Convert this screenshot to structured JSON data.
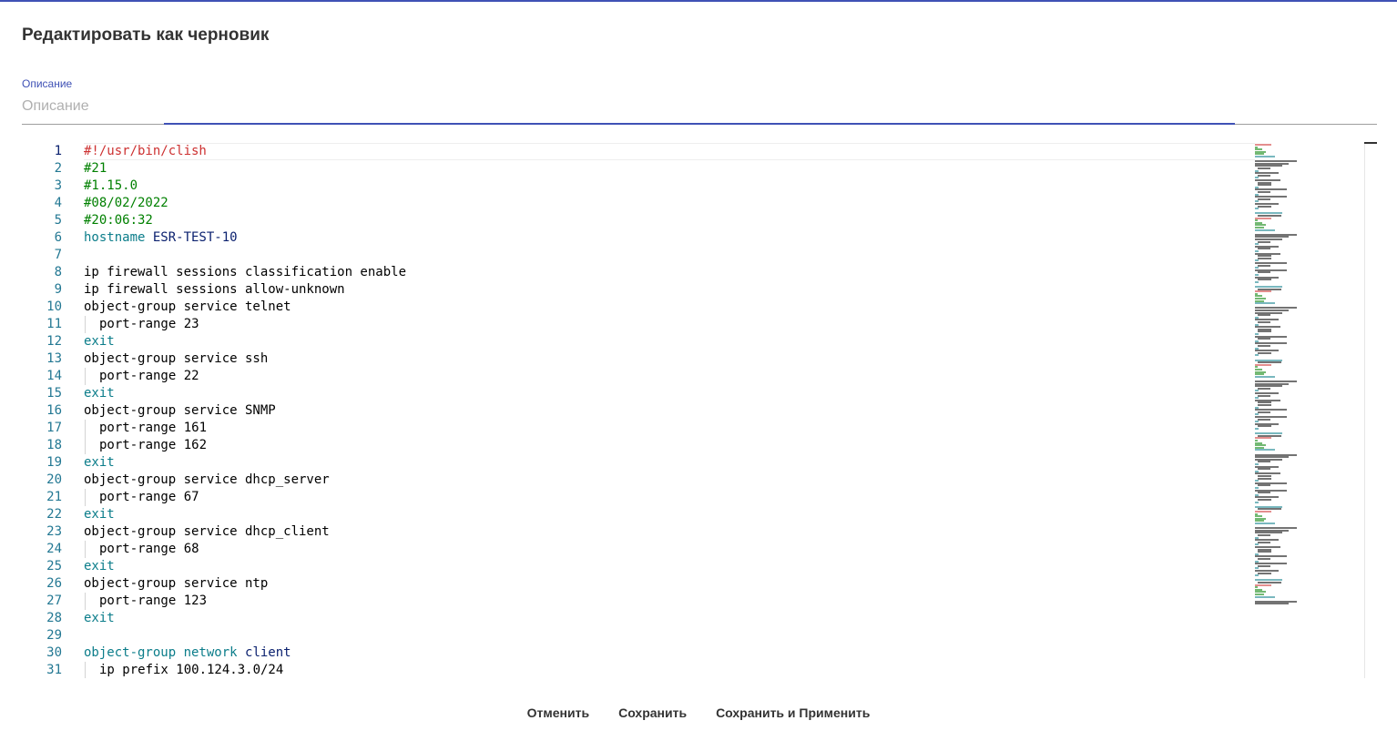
{
  "dialog": {
    "title": "Редактировать как черновик"
  },
  "description": {
    "label": "Описание",
    "placeholder": "Описание",
    "value": ""
  },
  "editor": {
    "active_line": 1,
    "lines": [
      {
        "n": "1",
        "indent": 0,
        "tokens": [
          {
            "t": "#!/usr/bin/clish",
            "c": "shebang"
          }
        ]
      },
      {
        "n": "2",
        "indent": 0,
        "tokens": [
          {
            "t": "#21",
            "c": "comment"
          }
        ]
      },
      {
        "n": "3",
        "indent": 0,
        "tokens": [
          {
            "t": "#1.15.0",
            "c": "comment"
          }
        ]
      },
      {
        "n": "4",
        "indent": 0,
        "tokens": [
          {
            "t": "#08/02/2022",
            "c": "comment"
          }
        ]
      },
      {
        "n": "5",
        "indent": 0,
        "tokens": [
          {
            "t": "#20:06:32",
            "c": "comment"
          }
        ]
      },
      {
        "n": "6",
        "indent": 0,
        "tokens": [
          {
            "t": "hostname ",
            "c": "key"
          },
          {
            "t": "ESR-TEST-10",
            "c": "val"
          }
        ]
      },
      {
        "n": "7",
        "indent": 0,
        "tokens": []
      },
      {
        "n": "8",
        "indent": 0,
        "tokens": [
          {
            "t": "ip firewall sessions classification enable",
            "c": "plain"
          }
        ]
      },
      {
        "n": "9",
        "indent": 0,
        "tokens": [
          {
            "t": "ip firewall sessions allow-unknown",
            "c": "plain"
          }
        ]
      },
      {
        "n": "10",
        "indent": 0,
        "tokens": [
          {
            "t": "object-group service telnet",
            "c": "plain"
          }
        ]
      },
      {
        "n": "11",
        "indent": 1,
        "tokens": [
          {
            "t": "port-range 23",
            "c": "plain"
          }
        ]
      },
      {
        "n": "12",
        "indent": 0,
        "tokens": [
          {
            "t": "exit",
            "c": "key"
          }
        ]
      },
      {
        "n": "13",
        "indent": 0,
        "tokens": [
          {
            "t": "object-group service ssh",
            "c": "plain"
          }
        ]
      },
      {
        "n": "14",
        "indent": 1,
        "tokens": [
          {
            "t": "port-range 22",
            "c": "plain"
          }
        ]
      },
      {
        "n": "15",
        "indent": 0,
        "tokens": [
          {
            "t": "exit",
            "c": "key"
          }
        ]
      },
      {
        "n": "16",
        "indent": 0,
        "tokens": [
          {
            "t": "object-group service SNMP",
            "c": "plain"
          }
        ]
      },
      {
        "n": "17",
        "indent": 1,
        "tokens": [
          {
            "t": "port-range 161",
            "c": "plain"
          }
        ]
      },
      {
        "n": "18",
        "indent": 1,
        "tokens": [
          {
            "t": "port-range 162",
            "c": "plain"
          }
        ]
      },
      {
        "n": "19",
        "indent": 0,
        "tokens": [
          {
            "t": "exit",
            "c": "key"
          }
        ]
      },
      {
        "n": "20",
        "indent": 0,
        "tokens": [
          {
            "t": "object-group service dhcp_server",
            "c": "plain"
          }
        ]
      },
      {
        "n": "21",
        "indent": 1,
        "tokens": [
          {
            "t": "port-range 67",
            "c": "plain"
          }
        ]
      },
      {
        "n": "22",
        "indent": 0,
        "tokens": [
          {
            "t": "exit",
            "c": "key"
          }
        ]
      },
      {
        "n": "23",
        "indent": 0,
        "tokens": [
          {
            "t": "object-group service dhcp_client",
            "c": "plain"
          }
        ]
      },
      {
        "n": "24",
        "indent": 1,
        "tokens": [
          {
            "t": "port-range 68",
            "c": "plain"
          }
        ]
      },
      {
        "n": "25",
        "indent": 0,
        "tokens": [
          {
            "t": "exit",
            "c": "key"
          }
        ]
      },
      {
        "n": "26",
        "indent": 0,
        "tokens": [
          {
            "t": "object-group service ntp",
            "c": "plain"
          }
        ]
      },
      {
        "n": "27",
        "indent": 1,
        "tokens": [
          {
            "t": "port-range 123",
            "c": "plain"
          }
        ]
      },
      {
        "n": "28",
        "indent": 0,
        "tokens": [
          {
            "t": "exit",
            "c": "key"
          }
        ]
      },
      {
        "n": "29",
        "indent": 0,
        "tokens": []
      },
      {
        "n": "30",
        "indent": 0,
        "tokens": [
          {
            "t": "object-group network ",
            "c": "key"
          },
          {
            "t": "client",
            "c": "val"
          }
        ]
      },
      {
        "n": "31",
        "indent": 1,
        "tokens": [
          {
            "t": "ip prefix 100.124.3.0/24",
            "c": "plain"
          }
        ]
      }
    ]
  },
  "colors": {
    "accent": "#3f51b5",
    "shebang": "#cd3131",
    "comment": "#008000",
    "keyword": "#0b7d8a",
    "value": "#0b216f",
    "line_number": "#237893"
  },
  "actions": {
    "cancel_label": "Отменить",
    "save_label": "Сохранить",
    "save_apply_label": "Сохранить и Применить"
  }
}
